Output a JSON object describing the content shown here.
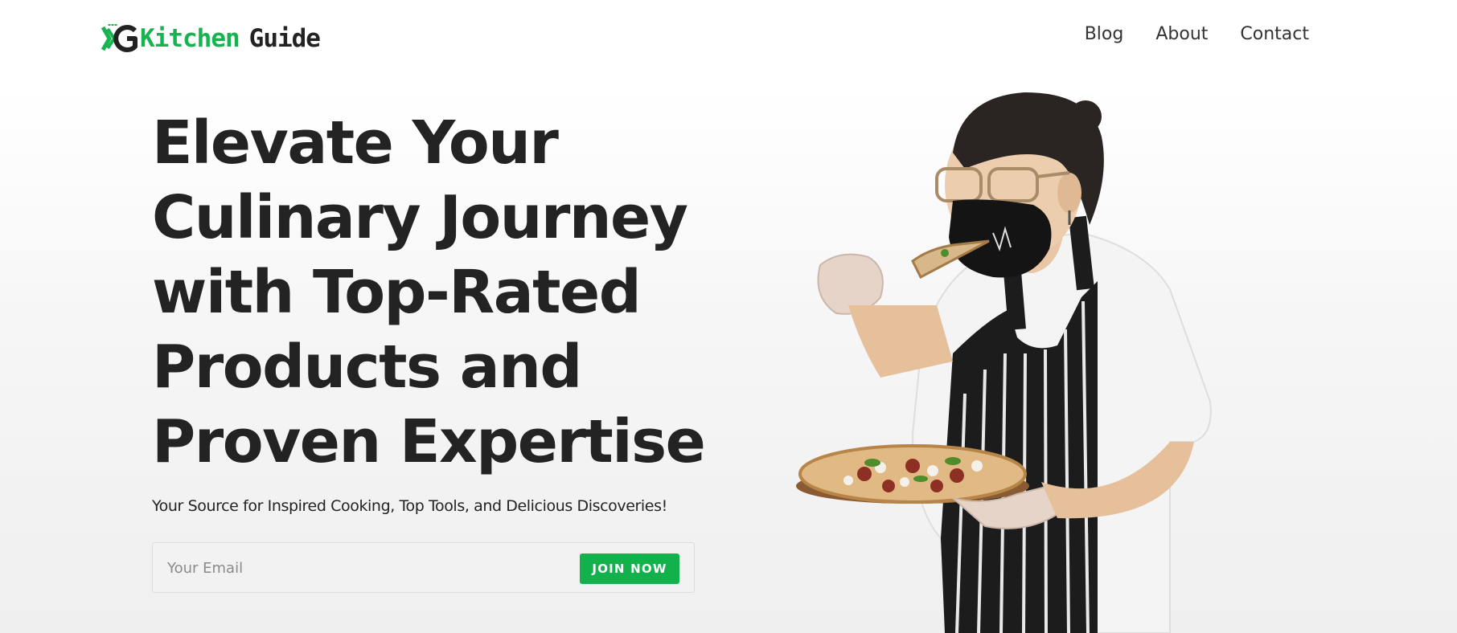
{
  "brand": {
    "word1": "Kitchen",
    "word2": "Guide",
    "accent_color": "#16b351",
    "logo_icon": "kg-logo-icon"
  },
  "nav": {
    "items": [
      {
        "label": "Blog"
      },
      {
        "label": "About"
      },
      {
        "label": "Contact"
      }
    ]
  },
  "hero": {
    "title": "Elevate Your Culinary Journey with Top-Rated Products and Proven Expertise",
    "subtitle": "Your Source for Inspired Cooking, Top Tools, and Delicious Discoveries!",
    "image_subject": "chef-eating-pizza-image"
  },
  "signup": {
    "email_placeholder": "Your Email",
    "email_value": "",
    "button_label": "JOIN NOW",
    "button_color": "#13b14c"
  }
}
